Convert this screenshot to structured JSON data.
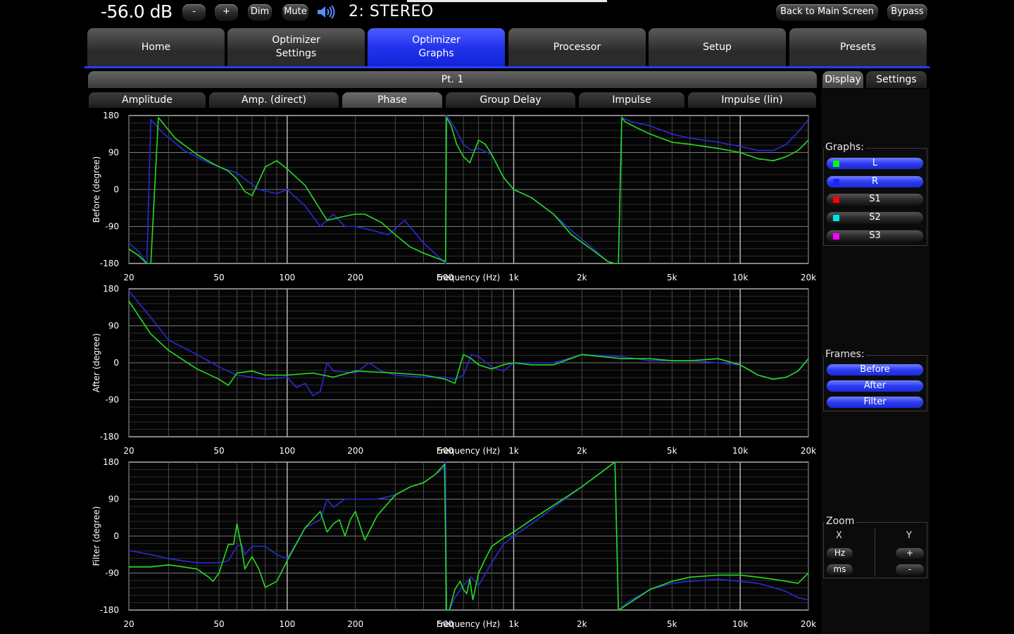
{
  "top": {
    "volume": "-56.0 dB",
    "minus": "-",
    "plus": "+",
    "dim": "Dim",
    "mute": "Mute",
    "channel": "2: STEREO",
    "back": "Back to Main Screen",
    "bypass": "Bypass"
  },
  "tabs": [
    {
      "label": "Home"
    },
    {
      "label": "Optimizer\nSettings"
    },
    {
      "label": "Optimizer\nGraphs",
      "active": true
    },
    {
      "label": "Processor"
    },
    {
      "label": "Setup"
    },
    {
      "label": "Presets"
    }
  ],
  "point": "Pt. 1",
  "subtabs": [
    "Amplitude",
    "Amp. (direct)",
    "Phase",
    "Group Delay",
    "Impulse",
    "Impulse (lin)"
  ],
  "active_subtab": "Phase",
  "right_tabs": {
    "display": "Display",
    "settings": "Settings"
  },
  "graphs_panel": {
    "title": "Graphs:",
    "items": [
      {
        "label": "L",
        "color": "#00ff00",
        "on": true
      },
      {
        "label": "R",
        "color": "#2020ff",
        "on": true
      },
      {
        "label": "S1",
        "color": "#ff0000",
        "on": false
      },
      {
        "label": "S2",
        "color": "#00e5e5",
        "on": false
      },
      {
        "label": "S3",
        "color": "#ff00ff",
        "on": false
      }
    ]
  },
  "frames_panel": {
    "title": "Frames:",
    "items": [
      "Before",
      "After",
      "Filter"
    ]
  },
  "zoom_panel": {
    "title": "Zoom",
    "x_label": "X",
    "y_label": "Y",
    "hz": "Hz",
    "ms": "ms",
    "plus": "+",
    "minus": "-"
  },
  "colors": {
    "accent": "#2a3cf0",
    "L": "#22dd22",
    "R": "#2a2ad8"
  },
  "chart_data": [
    {
      "type": "line",
      "ylabel": "Before (degree)",
      "xlabel": "Frequency (Hz)",
      "x_scale": "log",
      "xlim": [
        20,
        20000
      ],
      "ylim": [
        -180,
        180
      ],
      "yticks": [
        "180",
        "90",
        "0",
        "-90",
        "-180"
      ],
      "xticks": [
        "20",
        "50",
        "100",
        "200",
        "500",
        "1k",
        "2k",
        "5k",
        "10k",
        "20k"
      ],
      "series": [
        {
          "name": "L",
          "color": "#22dd22",
          "x": [
            20,
            22,
            24,
            25,
            27,
            32,
            40,
            48,
            55,
            60,
            65,
            70,
            75,
            80,
            90,
            100,
            120,
            150,
            180,
            200,
            220,
            260,
            300,
            350,
            400,
            500,
            505,
            530,
            560,
            600,
            640,
            700,
            750,
            800,
            900,
            1000,
            1200,
            1500,
            1800,
            2200,
            2600,
            2800,
            2900,
            3000,
            3100,
            3500,
            4000,
            5000,
            6000,
            8000,
            10000,
            12000,
            14000,
            16000,
            18000,
            20000
          ],
          "y": [
            -145,
            -160,
            -180,
            -180,
            175,
            125,
            85,
            60,
            45,
            25,
            -5,
            -15,
            20,
            55,
            70,
            50,
            10,
            -75,
            -65,
            -60,
            -60,
            -80,
            -110,
            -140,
            -155,
            -175,
            175,
            155,
            110,
            80,
            65,
            120,
            110,
            85,
            30,
            0,
            -20,
            -60,
            -110,
            -145,
            -175,
            -180,
            -180,
            175,
            165,
            150,
            135,
            115,
            110,
            100,
            90,
            75,
            70,
            80,
            95,
            120
          ]
        },
        {
          "name": "R",
          "color": "#2a2ad8",
          "x": [
            20,
            22,
            23,
            24,
            25,
            28,
            35,
            45,
            60,
            75,
            90,
            100,
            120,
            140,
            160,
            180,
            200,
            240,
            280,
            330,
            400,
            500,
            505,
            550,
            600,
            650,
            700,
            800,
            900,
            1000,
            1200,
            1500,
            1800,
            2200,
            2600,
            2800,
            2900,
            3000,
            3300,
            4000,
            5000,
            6000,
            8000,
            10000,
            12000,
            14000,
            16000,
            18000,
            20000
          ],
          "y": [
            -130,
            -150,
            -165,
            -180,
            170,
            140,
            95,
            65,
            40,
            0,
            -10,
            0,
            -40,
            -90,
            -60,
            -90,
            -90,
            -100,
            -110,
            -75,
            -130,
            -180,
            180,
            150,
            110,
            95,
            100,
            85,
            30,
            0,
            -20,
            -60,
            -100,
            -140,
            -175,
            -180,
            -180,
            175,
            165,
            155,
            135,
            125,
            115,
            105,
            95,
            95,
            110,
            140,
            170
          ]
        }
      ]
    },
    {
      "type": "line",
      "ylabel": "After (degree)",
      "xlabel": "Frequency (Hz)",
      "x_scale": "log",
      "xlim": [
        20,
        20000
      ],
      "ylim": [
        -180,
        180
      ],
      "yticks": [
        "180",
        "90",
        "0",
        "-90",
        "-180"
      ],
      "xticks": [
        "20",
        "50",
        "100",
        "200",
        "500",
        "1k",
        "2k",
        "5k",
        "10k",
        "20k"
      ],
      "series": [
        {
          "name": "L",
          "color": "#22dd22",
          "x": [
            20,
            25,
            30,
            40,
            50,
            55,
            60,
            70,
            80,
            100,
            130,
            160,
            200,
            300,
            400,
            500,
            550,
            600,
            650,
            700,
            800,
            900,
            1000,
            1200,
            1500,
            2000,
            3000,
            4000,
            5000,
            6000,
            8000,
            10000,
            12000,
            14000,
            16000,
            18000,
            20000
          ],
          "y": [
            150,
            70,
            30,
            -15,
            -40,
            -55,
            -25,
            -20,
            -30,
            -30,
            -25,
            -35,
            -20,
            -25,
            -30,
            -40,
            -50,
            20,
            10,
            -5,
            -15,
            -5,
            0,
            -5,
            -5,
            20,
            10,
            10,
            5,
            5,
            10,
            -5,
            -30,
            -40,
            -35,
            -20,
            10
          ]
        },
        {
          "name": "R",
          "color": "#2a2ad8",
          "x": [
            20,
            25,
            30,
            40,
            50,
            60,
            70,
            80,
            100,
            110,
            120,
            130,
            140,
            150,
            160,
            200,
            230,
            260,
            300,
            400,
            500,
            550,
            600,
            650,
            700,
            800,
            900,
            1000,
            1200,
            1500,
            2000,
            3000,
            4000,
            5000,
            6000,
            8000,
            10000,
            12000,
            14000,
            16000,
            18000,
            20000
          ],
          "y": [
            175,
            110,
            55,
            20,
            -10,
            -30,
            -35,
            -40,
            -35,
            -60,
            -50,
            -80,
            -70,
            0,
            -20,
            -25,
            0,
            -20,
            -30,
            -35,
            -35,
            -40,
            -30,
            20,
            15,
            -10,
            -20,
            0,
            0,
            0,
            20,
            15,
            5,
            5,
            5,
            0,
            -5,
            -30,
            -40,
            -35,
            -20,
            10
          ]
        }
      ]
    },
    {
      "type": "line",
      "ylabel": "Filter (degree)",
      "xlabel": "Frequency (Hz)",
      "x_scale": "log",
      "xlim": [
        20,
        20000
      ],
      "ylim": [
        -180,
        180
      ],
      "yticks": [
        "180",
        "90",
        "0",
        "-90",
        "-180"
      ],
      "xticks": [
        "20",
        "50",
        "100",
        "200",
        "500",
        "1k",
        "2k",
        "5k",
        "10k",
        "20k"
      ],
      "series": [
        {
          "name": "L",
          "color": "#22dd22",
          "x": [
            20,
            25,
            30,
            40,
            45,
            47,
            50,
            55,
            58,
            60,
            63,
            65,
            70,
            75,
            80,
            90,
            100,
            120,
            140,
            150,
            160,
            170,
            180,
            190,
            200,
            220,
            250,
            300,
            350,
            400,
            450,
            495,
            505,
            520,
            550,
            580,
            600,
            620,
            640,
            660,
            700,
            750,
            800,
            900,
            1000,
            1200,
            1500,
            2000,
            2500,
            2800,
            2900,
            3000,
            3200,
            4000,
            5000,
            6000,
            8000,
            10000,
            12000,
            14000,
            16000,
            18000,
            20000
          ],
          "y": [
            -75,
            -75,
            -70,
            -80,
            -100,
            -110,
            -90,
            -20,
            -20,
            30,
            -30,
            -80,
            -50,
            -80,
            -125,
            -110,
            -60,
            20,
            60,
            10,
            30,
            40,
            0,
            40,
            60,
            -10,
            50,
            100,
            120,
            130,
            150,
            175,
            -180,
            -180,
            -130,
            -110,
            -130,
            -140,
            -105,
            -155,
            -90,
            -55,
            -25,
            -5,
            10,
            40,
            75,
            120,
            160,
            180,
            -180,
            -175,
            -165,
            -130,
            -110,
            -100,
            -95,
            -95,
            -100,
            -105,
            -110,
            -115,
            -90
          ]
        },
        {
          "name": "R",
          "color": "#2a2ad8",
          "x": [
            20,
            25,
            30,
            40,
            50,
            55,
            60,
            63,
            65,
            70,
            80,
            90,
            100,
            120,
            140,
            150,
            160,
            180,
            200,
            250,
            300,
            350,
            400,
            450,
            490,
            500,
            505,
            520,
            550,
            600,
            650,
            700,
            800,
            900,
            1000,
            1200,
            1500,
            2000,
            2500,
            2800,
            2900,
            3000,
            3200,
            4000,
            5000,
            6000,
            8000,
            10000,
            12000,
            14000,
            16000,
            18000,
            20000
          ],
          "y": [
            -35,
            -45,
            -55,
            -65,
            -65,
            -60,
            -25,
            -20,
            -45,
            -25,
            -25,
            -45,
            -55,
            20,
            40,
            90,
            70,
            90,
            90,
            90,
            100,
            120,
            130,
            150,
            165,
            180,
            -180,
            -180,
            -150,
            -120,
            -100,
            -120,
            -65,
            -20,
            0,
            30,
            70,
            120,
            160,
            180,
            -180,
            -175,
            -160,
            -130,
            -115,
            -110,
            -105,
            -110,
            -115,
            -125,
            -135,
            -150,
            -155
          ]
        }
      ]
    }
  ]
}
